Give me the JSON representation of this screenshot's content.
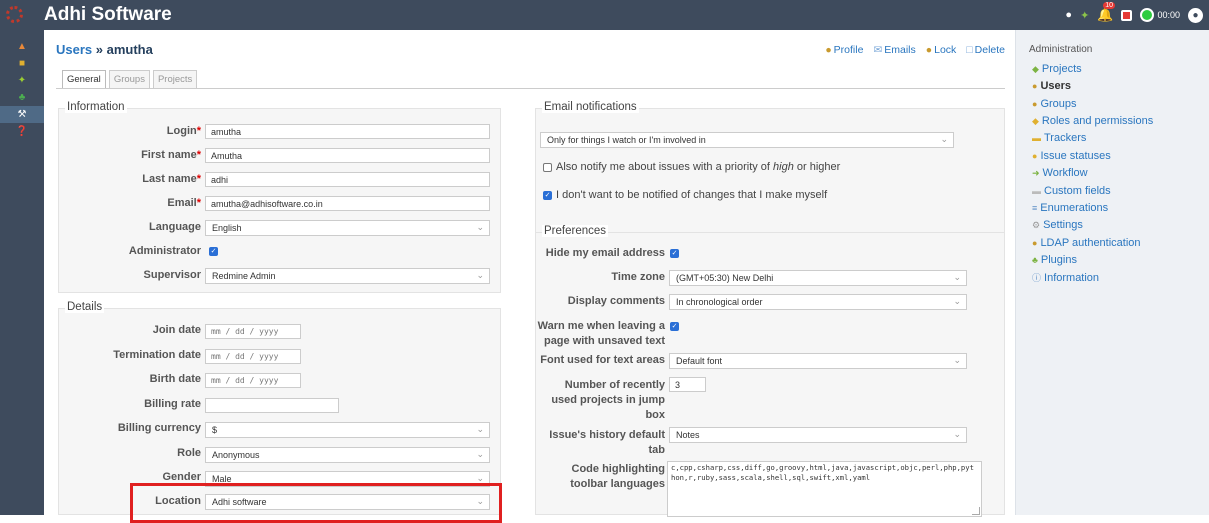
{
  "app": {
    "title": "Adhi Software"
  },
  "topbar": {
    "notif_count": "10",
    "timer": "00:00"
  },
  "breadcrumb": {
    "parent": "Users",
    "separator": " » ",
    "current": "amutha"
  },
  "actions": {
    "profile": "Profile",
    "emails": "Emails",
    "lock": "Lock",
    "delete": "Delete"
  },
  "tabs": {
    "general": "General",
    "groups": "Groups",
    "projects": "Projects"
  },
  "information": {
    "legend": "Information",
    "login_label": "Login",
    "login_value": "amutha",
    "firstname_label": "First name",
    "firstname_value": "Amutha",
    "lastname_label": "Last name",
    "lastname_value": "adhi",
    "email_label": "Email",
    "email_value": "amutha@adhisoftware.co.in",
    "language_label": "Language",
    "language_value": "English",
    "administrator_label": "Administrator",
    "supervisor_label": "Supervisor",
    "supervisor_value": "Redmine Admin",
    "required_mark": "*"
  },
  "details": {
    "legend": "Details",
    "join_label": "Join date",
    "join_placeholder": "mm / dd / yyyy",
    "termination_label": "Termination date",
    "termination_placeholder": "mm / dd / yyyy",
    "birth_label": "Birth date",
    "birth_placeholder": "mm / dd / yyyy",
    "billing_rate_label": "Billing rate",
    "billing_rate_value": "",
    "billing_currency_label": "Billing currency",
    "billing_currency_value": "$",
    "role_label": "Role",
    "role_value": "Anonymous",
    "gender_label": "Gender",
    "gender_value": "Male",
    "location_label": "Location",
    "location_value": "Adhi software"
  },
  "email_notifications": {
    "legend": "Email notifications",
    "mode_value": "Only for things I watch or I'm involved in",
    "priority_prefix": "Also notify me about issues with a priority of ",
    "priority_emph": "high",
    "priority_suffix": " or higher",
    "no_self_label": "I don't want to be notified of changes that I make myself"
  },
  "preferences": {
    "legend": "Preferences",
    "hide_email_label": "Hide my email address",
    "timezone_label": "Time zone",
    "timezone_value": "(GMT+05:30) New Delhi",
    "comments_label": "Display comments",
    "comments_value": "In chronological order",
    "warn_label_1": "Warn me when leaving a",
    "warn_label_2": "page with unsaved text",
    "font_label": "Font used for text areas",
    "font_value": "Default font",
    "recent_label_1": "Number of recently",
    "recent_label_2": "used projects in jump",
    "recent_label_3": "box",
    "recent_value": "3",
    "history_label_1": "Issue's history default",
    "history_label_2": "tab",
    "history_value": "Notes",
    "code_label_1": "Code highlighting",
    "code_label_2": "toolbar languages",
    "code_value": "c,cpp,csharp,css,diff,go,groovy,html,java,javascript,objc,perl,php,python,r,ruby,sass,scala,shell,sql,swift,xml,yaml"
  },
  "admin": {
    "title": "Administration",
    "items": [
      "Projects",
      "Users",
      "Groups",
      "Roles and permissions",
      "Trackers",
      "Issue statuses",
      "Workflow",
      "Custom fields",
      "Enumerations",
      "Settings",
      "LDAP authentication",
      "Plugins",
      "Information"
    ]
  },
  "colors": {
    "header": "#3e4b5d",
    "link": "#2a76bf",
    "highlight": "#e02020",
    "checkbox": "#2a6fd6"
  }
}
